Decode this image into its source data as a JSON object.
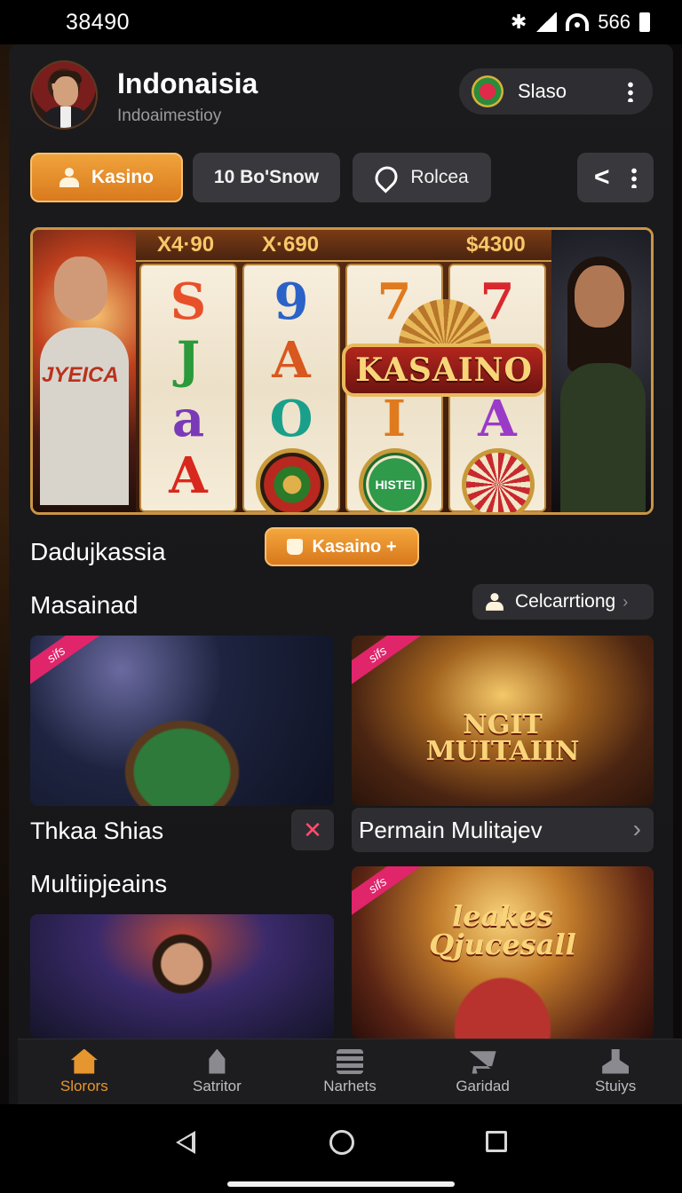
{
  "status_bar": {
    "time": "38490",
    "right_text": "566"
  },
  "header": {
    "title": "Indonaisia",
    "subtitle": "Indoaimestioy",
    "profile_label": "Slaso"
  },
  "tabs": [
    {
      "label": "Kasino",
      "icon": "person-icon",
      "active": true
    },
    {
      "label": "10 Bo'Snow",
      "icon": "",
      "active": false
    },
    {
      "label": "Rolcea",
      "icon": "heart-icon",
      "active": false
    }
  ],
  "banner": {
    "reel_values": [
      "X4·90",
      "X·690",
      "$4300"
    ],
    "logo_text": "KASAINO",
    "chip_text": "HISTEI",
    "shirt_text": "JYEICA"
  },
  "sections": {
    "first_title": "Dadujkassia",
    "kasino_button": "Kasaino +",
    "second_title": "Masainad",
    "see_all_label": "Celcarrtiong",
    "third_title": "Multiipjeains"
  },
  "cards": [
    {
      "ribbon": "sifs",
      "label": "Thkaa Shias",
      "action_icon": "close-icon"
    },
    {
      "ribbon": "sifs",
      "label": "Permain Mulitajev",
      "action_icon": "chevron-right-icon",
      "image_text": "NGIT MUITAIIN"
    },
    {
      "ribbon": "",
      "label": ""
    },
    {
      "ribbon": "sifs",
      "label": "",
      "image_text": "leakes Qjucesall"
    }
  ],
  "bottom_nav": [
    {
      "label": "Slorors",
      "icon": "home-icon",
      "active": true
    },
    {
      "label": "Satritor",
      "icon": "temple-icon",
      "active": false
    },
    {
      "label": "Narhets",
      "icon": "document-icon",
      "active": false
    },
    {
      "label": "Garidad",
      "icon": "cart-icon",
      "active": false
    },
    {
      "label": "Stuiys",
      "icon": "user-icon",
      "active": false
    }
  ],
  "colors": {
    "accent": "#e6962e",
    "panel": "#1b1b1d",
    "pill": "#2e2e32",
    "ribbon": "#e0256a"
  }
}
